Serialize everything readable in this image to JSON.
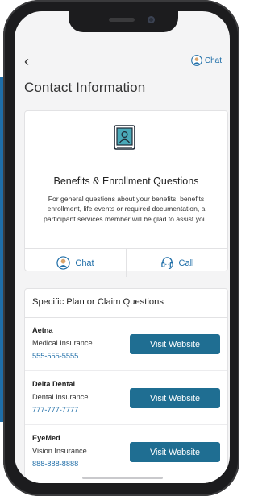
{
  "header": {
    "back_glyph": "‹",
    "chat_label": "Chat",
    "title": "Contact Information"
  },
  "benefits_card": {
    "icon": "book-person-icon",
    "heading": "Benefits & Enrollment Questions",
    "description": "For general questions about your benefits, benefits enrollment, life events or required documentation, a participant services member will be glad to assist you.",
    "chat_label": "Chat",
    "call_label": "Call"
  },
  "plans_card": {
    "heading": "Specific Plan or Claim Questions",
    "plans": [
      {
        "name": "Aetna",
        "type": "Medical Insurance",
        "phone": "555-555-5555",
        "button": "Visit Website"
      },
      {
        "name": "Delta Dental",
        "type": "Dental Insurance",
        "phone": "777-777-7777",
        "button": "Visit Website"
      },
      {
        "name": "EyeMed",
        "type": "Vision Insurance",
        "phone": "888-888-8888",
        "button": "Visit Website"
      }
    ]
  },
  "colors": {
    "accent": "#1f6ea8",
    "button": "#1f6e92",
    "frame": "#1c1c1e"
  }
}
